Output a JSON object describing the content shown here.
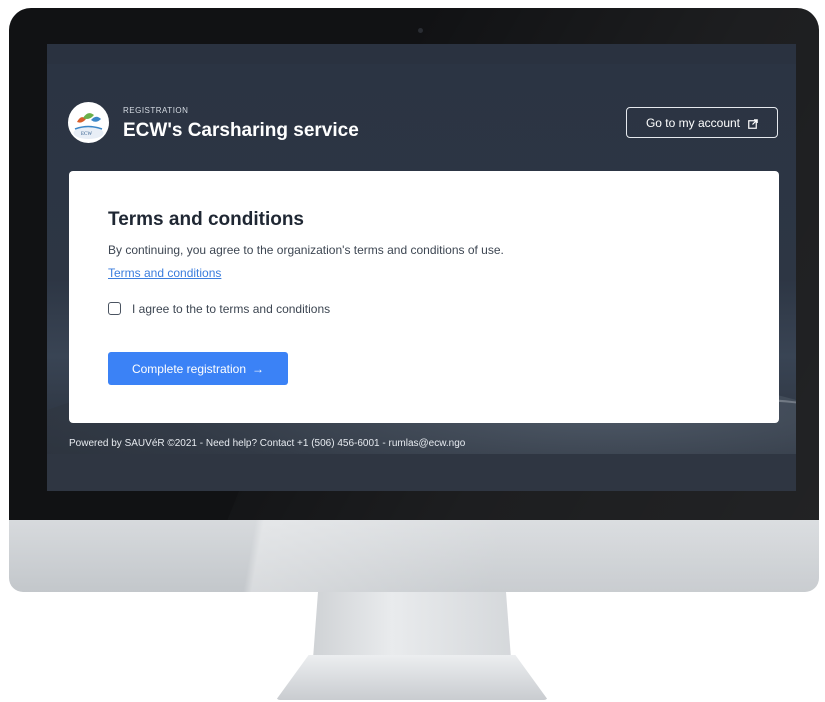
{
  "header": {
    "overline": "REGISTRATION",
    "title": "ECW's Carsharing service",
    "account_button": "Go to my account",
    "logo_text": "ECW"
  },
  "card": {
    "title": "Terms and conditions",
    "description": "By continuing, you agree to the organization's terms and conditions of use.",
    "link": "Terms and conditions",
    "checkbox_label": "I agree to the to terms and conditions",
    "checkbox_checked": false,
    "submit_button": "Complete registration",
    "submit_arrow": "→"
  },
  "footer": {
    "text": "Powered by SAUVéR ©2021 - Need help? Contact +1 (506) 456-6001 - rumlas@ecw.ngo"
  },
  "colors": {
    "primary": "#3b82f6",
    "link": "#3b7ddd",
    "header_bg": "#2b3443"
  }
}
